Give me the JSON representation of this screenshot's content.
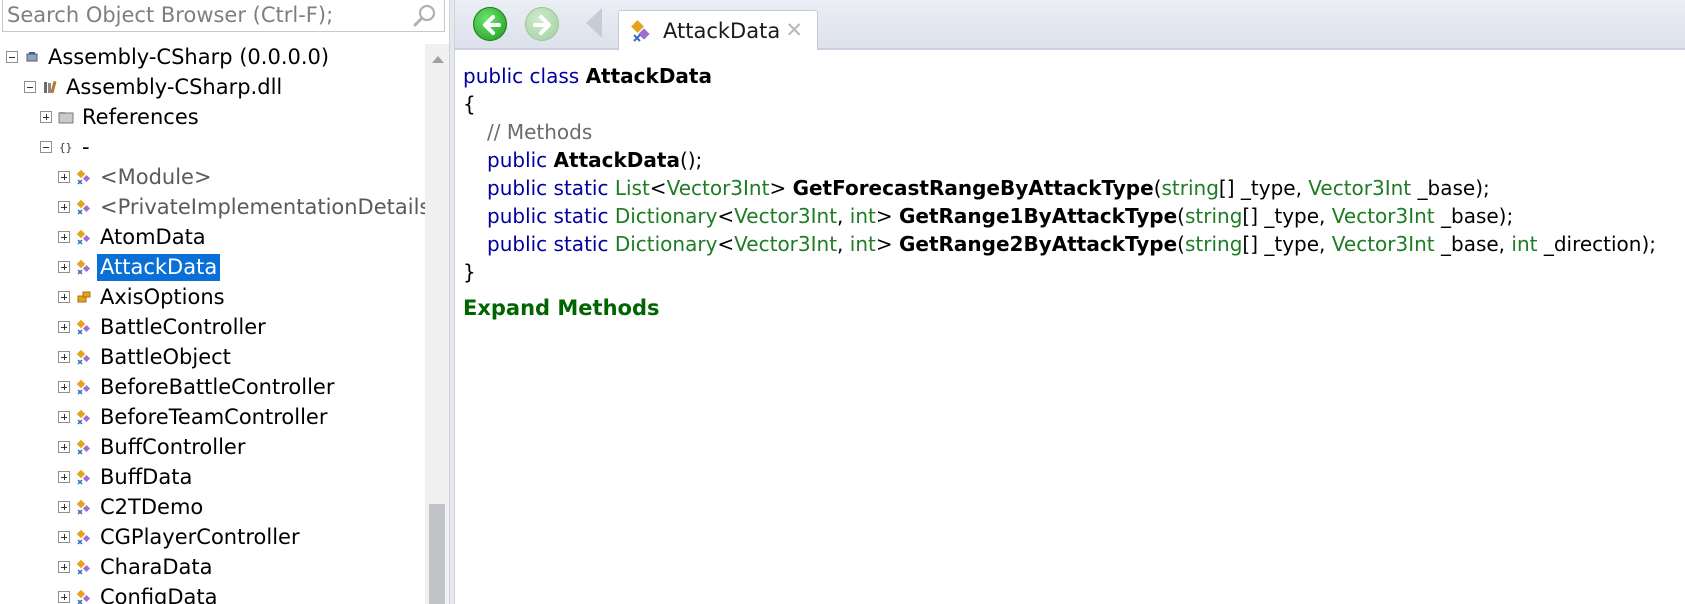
{
  "search": {
    "placeholder": "Search Object Browser (Ctrl-F);",
    "value": ""
  },
  "tree": {
    "items": [
      {
        "label": "Assembly-CSharp (0.0.0.0)",
        "icon": "assembly-icon",
        "expanded": true,
        "level": 0
      },
      {
        "label": "Assembly-CSharp.dll",
        "icon": "dll-library-icon",
        "expanded": true,
        "level": 1
      },
      {
        "label": "References",
        "icon": "references-folder-icon",
        "expanded": false,
        "level": 2
      },
      {
        "label": "-",
        "icon": "namespace-icon",
        "expanded": true,
        "level": 2
      },
      {
        "label": "<Module>",
        "icon": "class-icon",
        "expanded": false,
        "level": 3,
        "dim": true
      },
      {
        "label": "<PrivateImplementationDetails",
        "icon": "class-icon",
        "expanded": false,
        "level": 3,
        "dim": true
      },
      {
        "label": "AtomData",
        "icon": "class-icon",
        "expanded": false,
        "level": 3
      },
      {
        "label": "AttackData",
        "icon": "class-icon",
        "expanded": false,
        "level": 3,
        "selected": true
      },
      {
        "label": "AxisOptions",
        "icon": "enum-icon",
        "expanded": false,
        "level": 3
      },
      {
        "label": "BattleController",
        "icon": "class-icon",
        "expanded": false,
        "level": 3
      },
      {
        "label": "BattleObject",
        "icon": "class-icon",
        "expanded": false,
        "level": 3
      },
      {
        "label": "BeforeBattleController",
        "icon": "class-icon",
        "expanded": false,
        "level": 3
      },
      {
        "label": "BeforeTeamController",
        "icon": "class-icon",
        "expanded": false,
        "level": 3
      },
      {
        "label": "BuffController",
        "icon": "class-icon",
        "expanded": false,
        "level": 3
      },
      {
        "label": "BuffData",
        "icon": "class-icon",
        "expanded": false,
        "level": 3
      },
      {
        "label": "C2TDemo",
        "icon": "class-icon",
        "expanded": false,
        "level": 3
      },
      {
        "label": "CGPlayerController",
        "icon": "class-icon",
        "expanded": false,
        "level": 3
      },
      {
        "label": "CharaData",
        "icon": "class-icon",
        "expanded": false,
        "level": 3
      },
      {
        "label": "ConfigData",
        "icon": "class-icon",
        "expanded": false,
        "level": 3
      }
    ]
  },
  "toolbar": {
    "back_icon": "back-arrow-icon",
    "forward_icon": "forward-arrow-icon"
  },
  "tab": {
    "title": "AttackData",
    "close": "✕"
  },
  "code": {
    "kw_public": "public",
    "kw_class": "class",
    "kw_static": "static",
    "class_name": "AttackData",
    "open_brace": "{",
    "close_brace": "}",
    "comment": "// Methods",
    "ctor_name": "AttackData",
    "ctor_tail": "();",
    "m1": {
      "ret_type": "List",
      "ret_arg": "Vector3Int",
      "name": "GetForecastRangeByAttackType",
      "p1_type": "string",
      "p1_rest": "[] _type, ",
      "p2_type": "Vector3Int",
      "p2_rest": " _base);"
    },
    "m2": {
      "ret_type": "Dictionary",
      "ret_arg1": "Vector3Int",
      "ret_arg2": "int",
      "name": "GetRange1ByAttackType",
      "p1_type": "string",
      "p1_rest": "[] _type, ",
      "p2_type": "Vector3Int",
      "p2_rest": " _base);"
    },
    "m3": {
      "ret_type": "Dictionary",
      "ret_arg1": "Vector3Int",
      "ret_arg2": "int",
      "name": "GetRange2ByAttackType",
      "p1_type": "string",
      "p1_rest": "[] _type, ",
      "p2_type": "Vector3Int",
      "p2_rest": " _base, ",
      "p3_type": "int",
      "p3_rest": " _direction);"
    },
    "expand_link": "Expand Methods"
  },
  "colors": {
    "keyword": "#0000a0",
    "type": "#1e7c24",
    "comment": "#6c6c6c",
    "selection": "#0a6fd6",
    "link": "#006400"
  }
}
